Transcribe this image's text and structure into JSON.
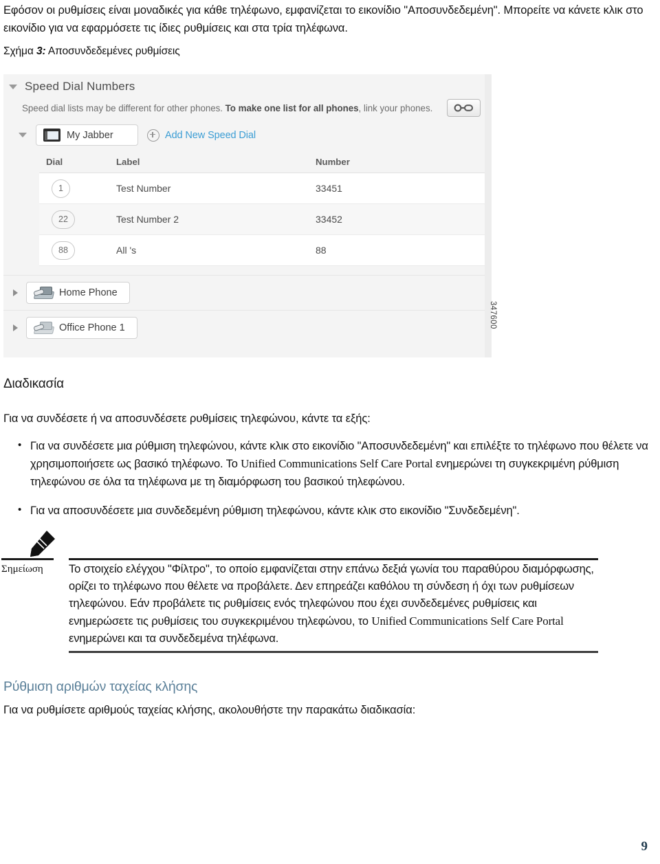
{
  "intro": {
    "paragraph": "Εφόσον οι ρυθμίσεις είναι μοναδικές για κάθε τηλέφωνο, εμφανίζεται το εικονίδιο \"Αποσυνδεδεμένη\". Μπορείτε να κάνετε κλικ στο εικονίδιο για να εφαρμόσετε τις ίδιες ρυθμίσεις και στα τρία τηλέφωνα."
  },
  "figure": {
    "caption_prefix": "Σχήμα ",
    "caption_number": "3:",
    "caption_text": " Αποσυνδεδεμένες ρυθμίσεις",
    "id_label": "347600",
    "screenshot": {
      "section_title": "Speed Dial Numbers",
      "subtitle_plain_start": "Speed dial lists may be different for other phones. ",
      "subtitle_bold": "To make one list for all phones",
      "subtitle_plain_end": ", link your phones.",
      "link_button_name": "link-phones-button",
      "device_chip_label": "My Jabber",
      "add_speed_dial_label": "Add New Speed Dial",
      "columns": [
        "Dial",
        "Label",
        "Number"
      ],
      "rows": [
        {
          "dial": "1",
          "label": "Test Number",
          "number": "33451"
        },
        {
          "dial": "22",
          "label": "Test Number 2",
          "number": "33452"
        },
        {
          "dial": "88",
          "label": "All 's",
          "number": "88"
        }
      ],
      "other_devices": [
        {
          "label": "Home Phone"
        },
        {
          "label": "Office Phone 1"
        }
      ],
      "accent_link_color": "#3b9dd4"
    }
  },
  "procedure": {
    "heading": "Διαδικασία",
    "lead": "Για να συνδέσετε ή να αποσυνδέσετε ρυθμίσεις τηλεφώνου, κάντε τα εξής:",
    "bullets": [
      {
        "part1": "Για να συνδέσετε μια ρύθμιση τηλεφώνου, κάντε κλικ στο εικονίδιο \"Αποσυνδεδεμένη\" και επιλέξτε το τηλέφωνο που θέλετε να χρησιμοποιήσετε ως βασικό τηλέφωνο. Το ",
        "product": "Unified Communications Self Care Portal",
        "part2": " ενημερώνει τη συγκεκριμένη ρύθμιση τηλεφώνου σε όλα τα τηλέφωνα με τη διαμόρφωση του βασικού τηλεφώνου."
      },
      {
        "part1": "Για να αποσυνδέσετε μια συνδεδεμένη ρύθμιση τηλεφώνου, κάντε κλικ στο εικονίδιο \"Συνδεδεμένη\".",
        "product": "",
        "part2": ""
      }
    ]
  },
  "note": {
    "label": "Σημείωση",
    "text_part1": "Το στοιχείο ελέγχου \"Φίλτρο\", το οποίο εμφανίζεται στην επάνω δεξιά γωνία του παραθύρου διαμόρφωσης, ορίζει το τηλέφωνο που θέλετε να προβάλετε. Δεν επηρεάζει καθόλου τη σύνδεση ή όχι των ρυθμίσεων τηλεφώνου. Εάν προβάλετε τις ρυθμίσεις ενός τηλεφώνου που έχει συνδεδεμένες ρυθμίσεις και ενημερώσετε τις ρυθμίσεις του συγκεκριμένου τηλεφώνου, το ",
    "product": "Unified Communications Self Care Portal",
    "text_part2": " ενημερώνει και τα συνδεδεμένα τηλέφωνα."
  },
  "next_section": {
    "heading": "Ρύθμιση αριθμών ταχείας κλήσης",
    "heading_color": "#5b8099",
    "lead": "Για να ρυθμίσετε αριθμούς ταχείας κλήσης, ακολουθήστε την παρακάτω διαδικασία:"
  },
  "footer": {
    "page_number": "9"
  }
}
